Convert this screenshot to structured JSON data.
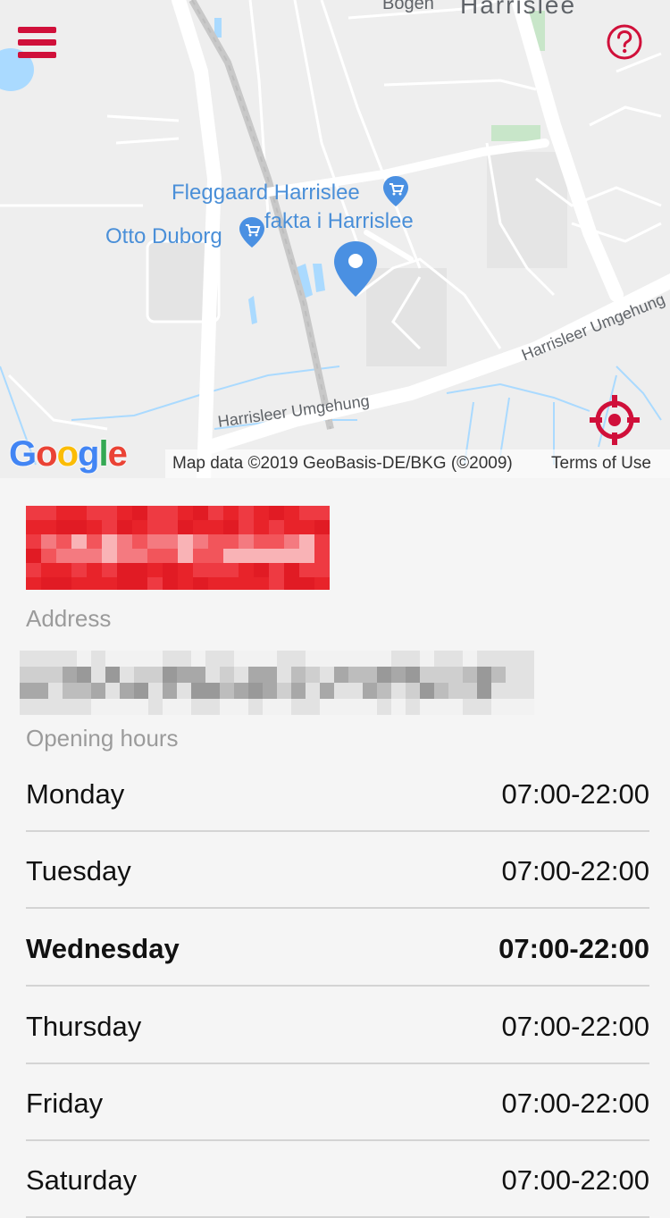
{
  "map": {
    "labels": {
      "fleggaard": "Fleggaard Harrislee",
      "fakta": "fakta i Harrislee",
      "otto": "Otto Duborg",
      "harrislee_town": "Harrislee",
      "bogen": "Bogen",
      "umgehung_bottom": "Harrisleer Umgehung",
      "umgehung_right": "Harrisleer Umgehung"
    },
    "attribution": "Map data ©2019 GeoBasis-DE/BKG (©2009)",
    "terms": "Terms of Use",
    "logo_letters": [
      "G",
      "o",
      "o",
      "g",
      "l",
      "e"
    ],
    "logo_colors": [
      "#4285F4",
      "#EA4335",
      "#FBBC05",
      "#4285F4",
      "#34A853",
      "#EA4335"
    ],
    "icons": {
      "menu": "hamburger-menu-icon",
      "help": "help-question-icon",
      "locate": "crosshair-locate-icon",
      "pin": "location-pin-icon",
      "poi": "shopping-cart-icon"
    }
  },
  "colors": {
    "accent": "#d0103a",
    "pin": "#4a90e2",
    "store_name_bg": "#e8232a"
  },
  "details": {
    "address_label": "Address",
    "opening_hours_label": "Opening hours",
    "hours": [
      {
        "day": "Monday",
        "time": "07:00-22:00",
        "today": false
      },
      {
        "day": "Tuesday",
        "time": "07:00-22:00",
        "today": false
      },
      {
        "day": "Wednesday",
        "time": "07:00-22:00",
        "today": true
      },
      {
        "day": "Thursday",
        "time": "07:00-22:00",
        "today": false
      },
      {
        "day": "Friday",
        "time": "07:00-22:00",
        "today": false
      },
      {
        "day": "Saturday",
        "time": "07:00-22:00",
        "today": false
      }
    ]
  }
}
